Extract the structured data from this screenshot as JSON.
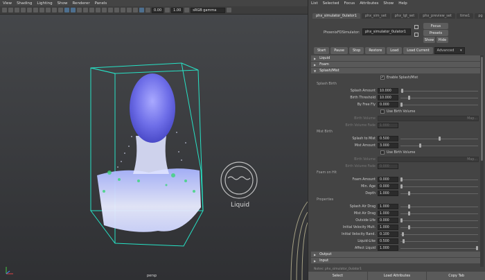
{
  "viewport": {
    "menu": [
      "View",
      "Shading",
      "Lighting",
      "Show",
      "Renderer",
      "Panels"
    ],
    "toolbar": {
      "field1": "0.00",
      "field2": "1.00",
      "colorspace": "sRGB gamma"
    },
    "camera_label": "persp",
    "watermark": "Liquid",
    "colors": {
      "bbox": "#27e3c6",
      "sim_blue": "#6e6ee8",
      "sim_white": "#e8ecff",
      "sim_green": "#3bd67a"
    }
  },
  "editor": {
    "menu": [
      "List",
      "Selected",
      "Focus",
      "Attributes",
      "Show",
      "Help"
    ],
    "tabs": [
      "phx_simulator_0ulator1",
      "phx_sim_set",
      "phx_lgt_set",
      "phx_preview_set",
      "time1",
      "pg"
    ],
    "node_label": "PhoenixFDSimulator:",
    "node_value": "phx_simulator_0ulator1",
    "focus_label": "Focus",
    "presets_label": "Presets",
    "show_label": "Show",
    "hide_label": "Hide",
    "actions": [
      "Start",
      "Pause",
      "Stop",
      "Restore",
      "Load",
      "Load Current"
    ],
    "advanced": "Advanced",
    "sections": {
      "liquid": "Liquid",
      "foam": "Foam",
      "splash": "Splash/Mist",
      "output": "Output",
      "input": "Input"
    },
    "enable_splash": "Enable Splash/Mist",
    "splash_birth_header": "Splash Birth",
    "mist_birth_header": "Mist Birth",
    "foam_on_hit_header": "Foam on Hit",
    "properties_header": "Properties",
    "fields": {
      "splash_amount": {
        "label": "Splash Amount",
        "value": "10.000",
        "knob": 0.01
      },
      "birth_threshold": {
        "label": "Birth Threshold",
        "value": "10.000",
        "knob": 0.1
      },
      "by_free_fly": {
        "label": "By Free Fly",
        "value": "0.000",
        "knob": 0.0
      },
      "use_birth_volume": "Use Birth Volume",
      "birth_volume": {
        "label": "Birth Volume",
        "map": "Map..."
      },
      "birth_volume_fade": {
        "label": "Birth Volume Fade",
        "value": "1.000"
      },
      "splash_to_mist": {
        "label": "Splash to Mist",
        "value": "0.500",
        "knob": 0.5
      },
      "mist_amount": {
        "label": "Mist Amount",
        "value": "3.000",
        "knob": 0.25
      },
      "use_birth_volume_2": "Use Birth Volume",
      "birth_volume_2": {
        "label": "Birth Volume",
        "map": "Map..."
      },
      "birth_volume_fade_2": {
        "label": "Birth Volume Fade",
        "value": "0.000"
      },
      "foam_amount": {
        "label": "Foam Amount",
        "value": "0.000",
        "knob": 0.0
      },
      "min_age": {
        "label": "Min. Age",
        "value": "0.000",
        "knob": 0.0
      },
      "depth": {
        "label": "Depth",
        "value": "1.000",
        "knob": 0.1
      },
      "splash_air_drag": {
        "label": "Splash Air Drag",
        "value": "1.000",
        "knob": 0.1
      },
      "mist_air_drag": {
        "label": "Mist Air Drag",
        "value": "1.000",
        "knob": 0.1
      },
      "outside_life": {
        "label": "Outside Life",
        "value": "0.000",
        "knob": 0.0
      },
      "initial_velocity_mult": {
        "label": "Initial Velocity Mult.",
        "value": "1.000",
        "knob": 0.1
      },
      "initial_velocity_rand": {
        "label": "Initial Velocity Rand.",
        "value": "0.100",
        "knob": 0.02
      },
      "liquid_like": {
        "label": "Liquid-Like",
        "value": "0.500",
        "knob": 0.03
      },
      "affect_liquid": {
        "label": "Affect Liquid",
        "value": "1.000",
        "knob": 1.0
      }
    },
    "notes": "Notes:  phx_simulator_0ulator1",
    "bottom_buttons": [
      "Select",
      "Load Attributes",
      "Copy Tab"
    ]
  }
}
